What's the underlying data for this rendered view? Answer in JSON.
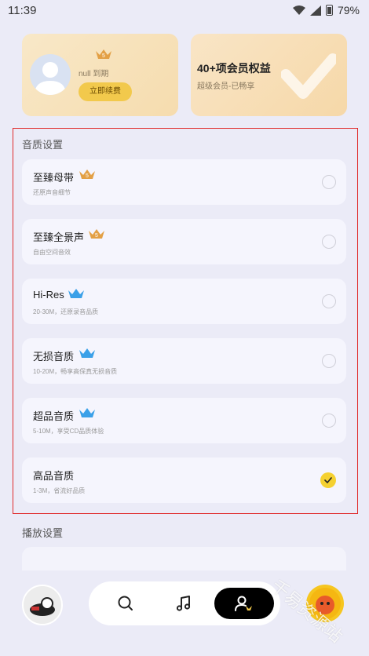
{
  "status_bar": {
    "time": "11:39",
    "battery": "79%"
  },
  "vip_card": {
    "user_status": "null 到期",
    "renew_label": "立即续费",
    "badge_level": "5"
  },
  "benefit_card": {
    "title": "40+项会员权益",
    "subtitle": "超级会员-已畅享"
  },
  "quality": {
    "title": "音质设置",
    "options": [
      {
        "name": "至臻母带",
        "desc": "还原声音细节",
        "badge": "crown-gold",
        "badge_text": "5",
        "selected": false
      },
      {
        "name": "至臻全景声",
        "desc": "自由空间音效",
        "badge": "crown-gold",
        "badge_text": "5",
        "selected": false
      },
      {
        "name": "Hi-Res",
        "desc": "20-30M，还原录音品质",
        "badge": "crown-blue",
        "selected": false
      },
      {
        "name": "无损音质",
        "desc": "10-20M，畅享高保真无损音质",
        "badge": "crown-blue",
        "selected": false
      },
      {
        "name": "超品音质",
        "desc": "5-10M，享受CD品质体验",
        "badge": "crown-blue",
        "selected": false
      },
      {
        "name": "高品音质",
        "desc": "1-3M，省流好品质",
        "badge": "",
        "selected": true
      }
    ]
  },
  "playback": {
    "title": "播放设置"
  },
  "nav": {
    "tabs": [
      "search",
      "music",
      "profile"
    ],
    "active": "profile"
  },
  "watermark": "千易资源站",
  "colors": {
    "accent_yellow": "#f5d131",
    "highlight_border": "#e02a2a",
    "bg": "#ebebf7"
  }
}
